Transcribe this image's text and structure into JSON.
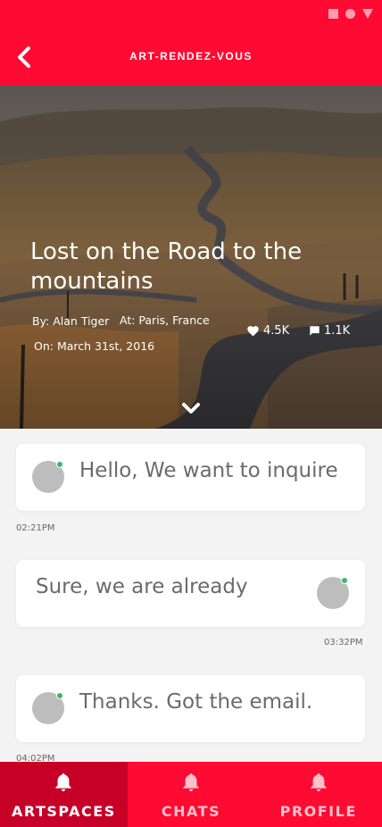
{
  "header": {
    "title": "ART-RENDEZ-VOUS",
    "status_icons": [
      "square-icon",
      "circle-icon",
      "triangle-icon"
    ],
    "back_icon": "chevron-left-icon",
    "color": "#ff0a32"
  },
  "hero": {
    "title": "Lost on the Road to the mountains",
    "author": "By: Alan Tiger",
    "location": "At: Paris, France",
    "date": "On: March 31st, 2016",
    "likes": "4.5K",
    "comments": "1.1K",
    "like_icon": "heart-icon",
    "comment_icon": "comment-icon",
    "expand_icon": "chevron-down-icon"
  },
  "messages": [
    {
      "text": "Hello, We want to inquire",
      "time": "02:21PM",
      "side": "left",
      "online": true
    },
    {
      "text": "Sure, we are already",
      "time": "03:32PM",
      "side": "right",
      "online": true
    },
    {
      "text": "Thanks. Got the email.",
      "time": "04:02PM",
      "side": "left",
      "online": true
    }
  ],
  "nav": {
    "items": [
      {
        "label": "ARTSPACES",
        "icon": "bell-icon",
        "active": true
      },
      {
        "label": "CHATS",
        "icon": "bell-icon",
        "active": false
      },
      {
        "label": "PROFILE",
        "icon": "bell-icon",
        "active": false
      }
    ],
    "active_color": "#c70028"
  }
}
